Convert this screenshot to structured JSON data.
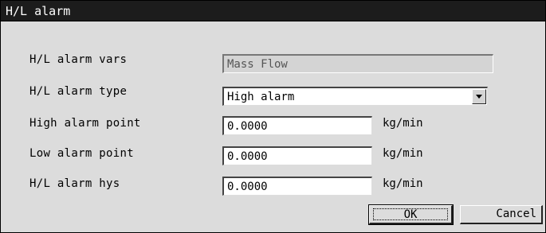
{
  "window": {
    "title": "H/L alarm"
  },
  "form": {
    "vars": {
      "label": "H/L alarm vars",
      "value": "Mass Flow"
    },
    "type": {
      "label": "H/L alarm type",
      "value": "High alarm"
    },
    "high_point": {
      "label": "High alarm point",
      "value": "0.0000",
      "unit": "kg/min"
    },
    "low_point": {
      "label": "Low alarm point",
      "value": "0.0000",
      "unit": "kg/min"
    },
    "hys": {
      "label": "H/L alarm hys",
      "value": "0.0000",
      "unit": "kg/min"
    }
  },
  "buttons": {
    "ok": "OK",
    "cancel": "Cancel"
  }
}
